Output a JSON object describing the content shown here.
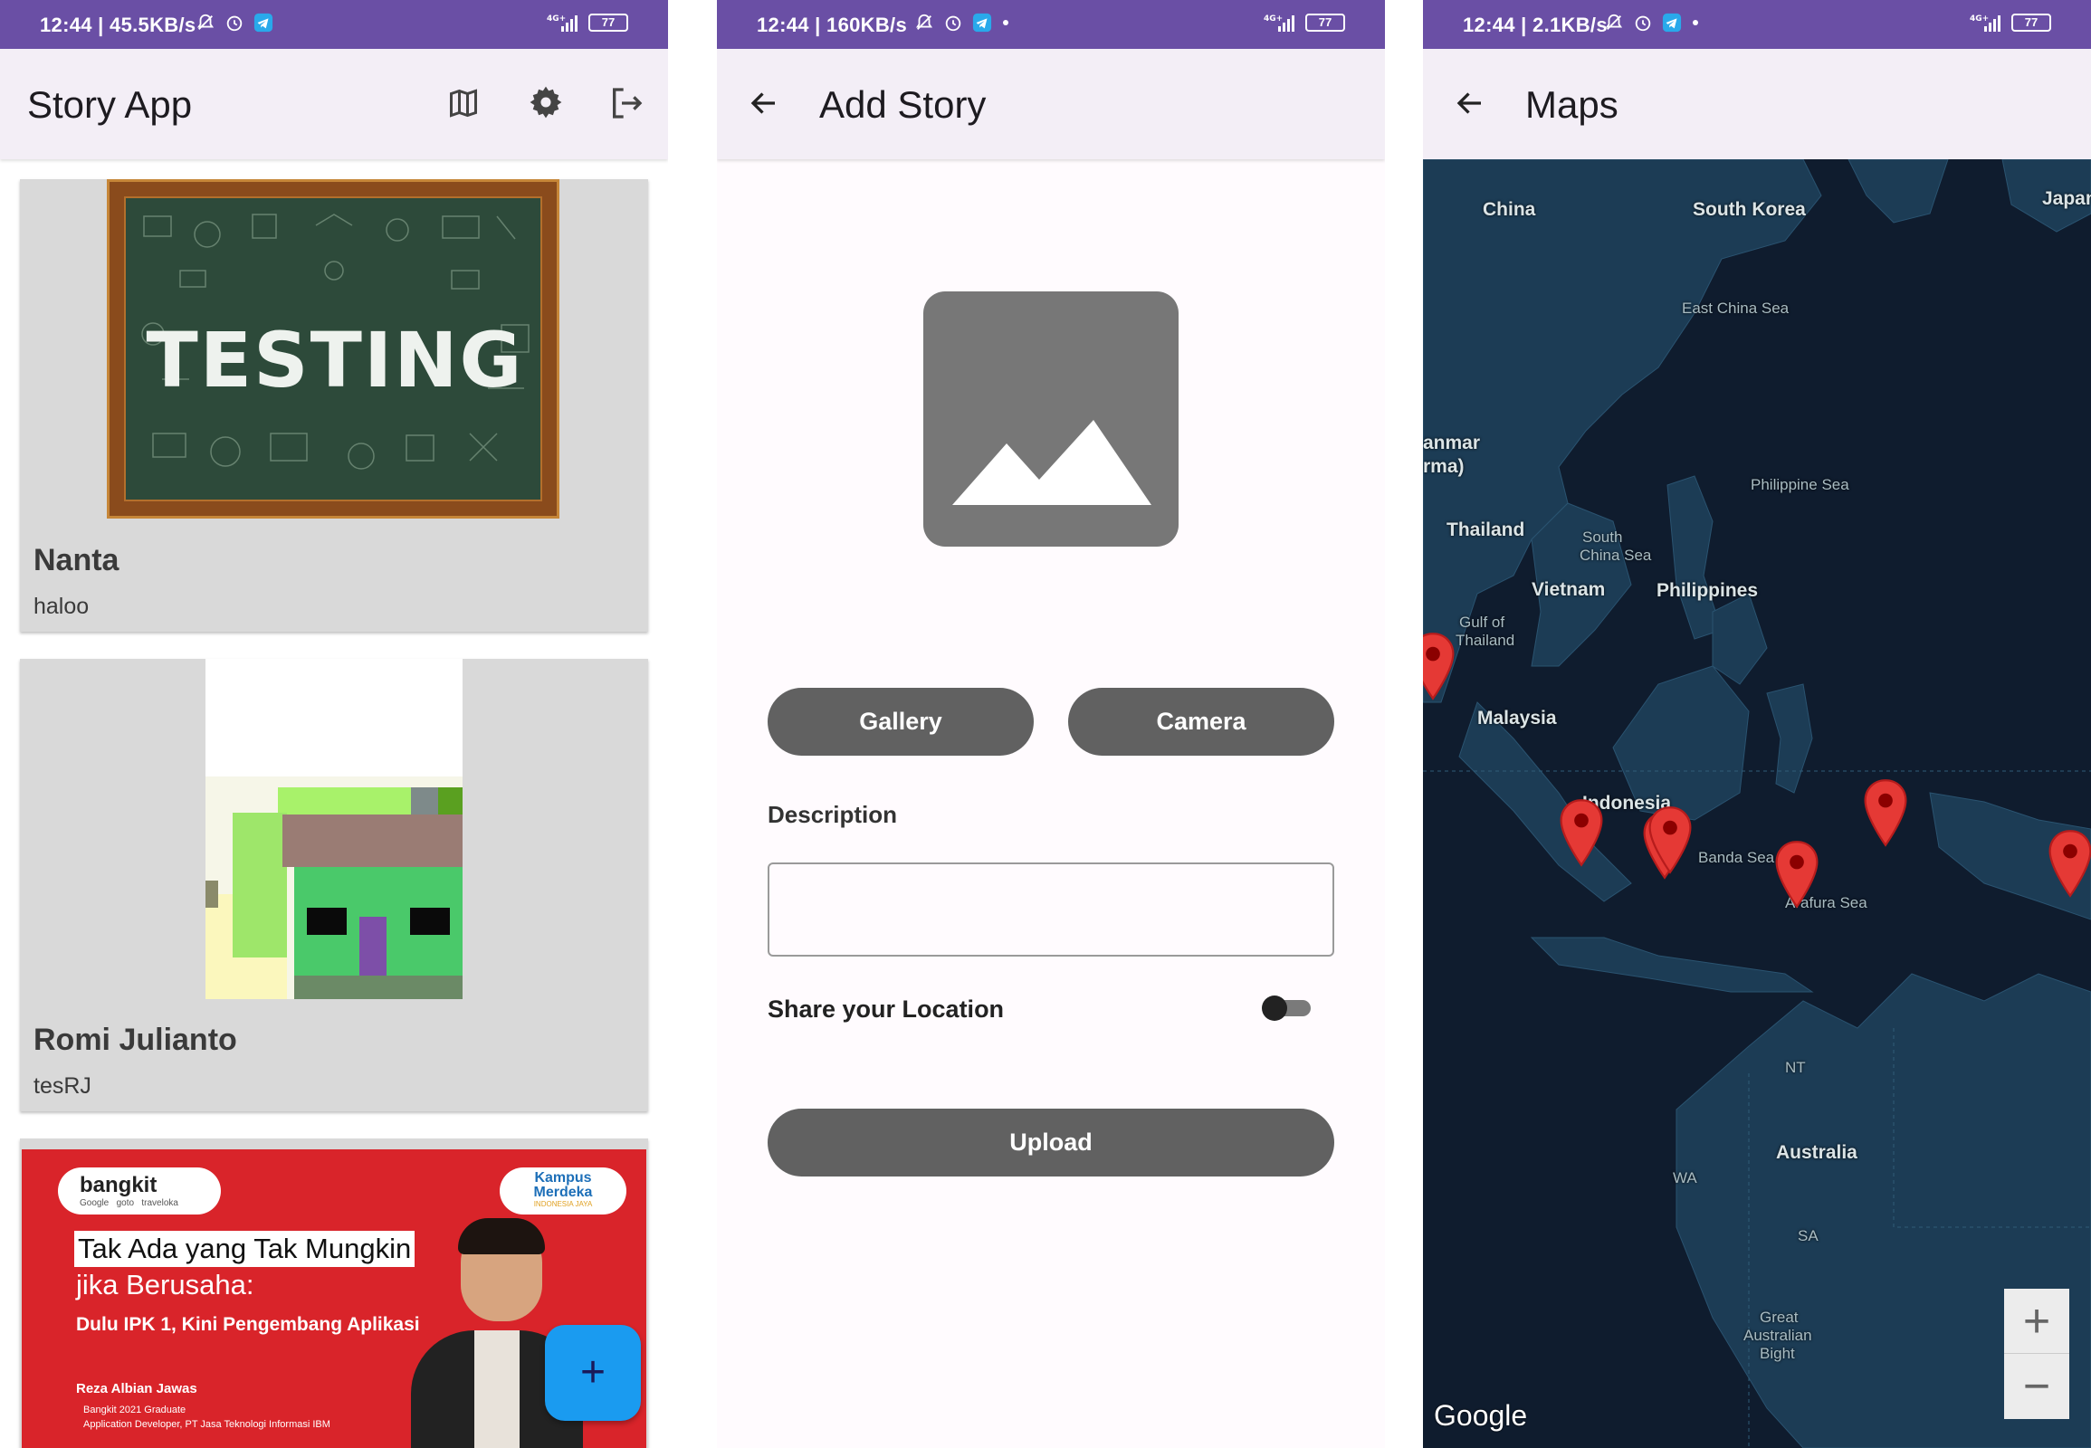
{
  "screen1": {
    "status": {
      "time_speed": "12:44 | 45.5KB/s",
      "battery": "77",
      "network": "4G+"
    },
    "title": "Story App",
    "stories": [
      {
        "name": "Nanta",
        "description": "haloo",
        "image_text": "TESTING"
      },
      {
        "name": "Romi Julianto",
        "description": "tesRJ"
      }
    ],
    "banner": {
      "brand": "bangkit",
      "sponsors": "Google   goto   traveloka",
      "partner_line1": "Kampus",
      "partner_line2": "Merdeka",
      "partner_line3": "INDONESIA JAYA",
      "headline1": "Tak Ada yang Tak Mungkin",
      "headline2": "jika Berusaha:",
      "subheadline": "Dulu IPK 1, Kini Pengembang Aplikasi",
      "person": "Reza Albian Jawas",
      "role1": "Bangkit 2021 Graduate",
      "role2": "Application Developer, PT Jasa Teknologi Informasi IBM"
    },
    "fab_label": "+"
  },
  "screen2": {
    "status": {
      "time_speed": "12:44 | 160KB/s",
      "battery": "77",
      "network": "4G+"
    },
    "title": "Add Story",
    "gallery_label": "Gallery",
    "camera_label": "Camera",
    "description_label": "Description",
    "description_value": "",
    "share_location_label": "Share your Location",
    "share_location_enabled": false,
    "upload_label": "Upload"
  },
  "screen3": {
    "status": {
      "time_speed": "12:44 | 2.1KB/s",
      "battery": "77",
      "network": "4G+"
    },
    "title": "Maps",
    "labels": {
      "china": "China",
      "south_korea": "South Korea",
      "japan": "Japan",
      "east_china_sea": "East China Sea",
      "myanmar1": "anmar",
      "myanmar2": "rma)",
      "philippine_sea": "Philippine Sea",
      "thailand": "Thailand",
      "south_china_sea1": "South",
      "south_china_sea2": "China Sea",
      "vietnam": "Vietnam",
      "philippines": "Philippines",
      "gulf1": "Gulf of",
      "gulf2": "Thailand",
      "malaysia": "Malaysia",
      "indonesia": "Indonesia",
      "banda_sea": "Banda Sea",
      "arafura_sea": "Arafura Sea",
      "nt": "NT",
      "australia": "Australia",
      "wa": "WA",
      "sa": "SA",
      "bight1": "Great",
      "bight2": "Australian",
      "bight3": "Bight"
    },
    "google_logo": "Google",
    "zoom_in": "+",
    "zoom_out": "−"
  },
  "colors": {
    "status_bar": "#6a4fa5",
    "app_bar": "#f3eef6",
    "button": "#616161",
    "fab": "#1a9bf0",
    "pin": "#e53935",
    "map": "#0f1c2e"
  }
}
